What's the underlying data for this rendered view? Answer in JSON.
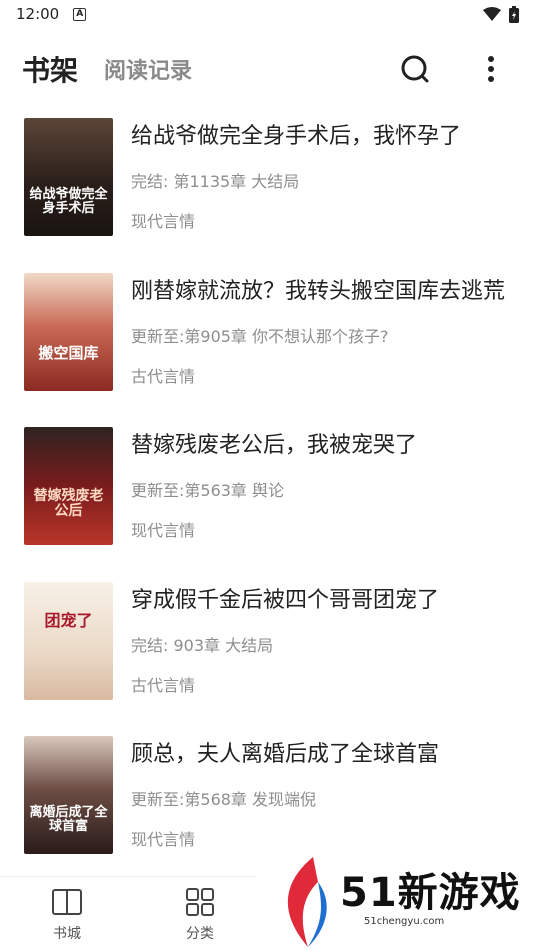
{
  "status": {
    "time": "12:00",
    "notification": "A"
  },
  "header": {
    "tab_shelf": "书架",
    "tab_history": "阅读记录"
  },
  "books": [
    {
      "title": "给战爷做完全身手术后，我怀孕了",
      "progress": "完结: 第1135章 大结局",
      "genre": "现代言情",
      "cover_text": "给战爷做完全身手术后",
      "cover_bg": "#3a2a24"
    },
    {
      "title": "刚替嫁就流放？我转头搬空国库去逃荒",
      "progress": "更新至:第905章 你不想认那个孩子?",
      "genre": "古代言情",
      "cover_text": "搬空国库",
      "cover_bg": "#8a2a22"
    },
    {
      "title": "替嫁残废老公后，我被宠哭了",
      "progress": "更新至:第563章 舆论",
      "genre": "现代言情",
      "cover_text": "替嫁残废老公后",
      "cover_bg": "#7a1c1c"
    },
    {
      "title": "穿成假千金后被四个哥哥团宠了",
      "progress": "完结: 903章 大结局",
      "genre": "古代言情",
      "cover_text": "团宠了",
      "cover_bg": "#f3ece2"
    },
    {
      "title": "顾总，夫人离婚后成了全球首富",
      "progress": "更新至:第568章 发现端倪",
      "genre": "现代言情",
      "cover_text": "离婚后成了全球首富",
      "cover_bg": "#3b2c2a"
    }
  ],
  "bottom_nav": [
    {
      "label": "书城"
    },
    {
      "label": "分类"
    }
  ],
  "watermark": {
    "text": "51新游戏",
    "url": "51chengyu.com"
  }
}
